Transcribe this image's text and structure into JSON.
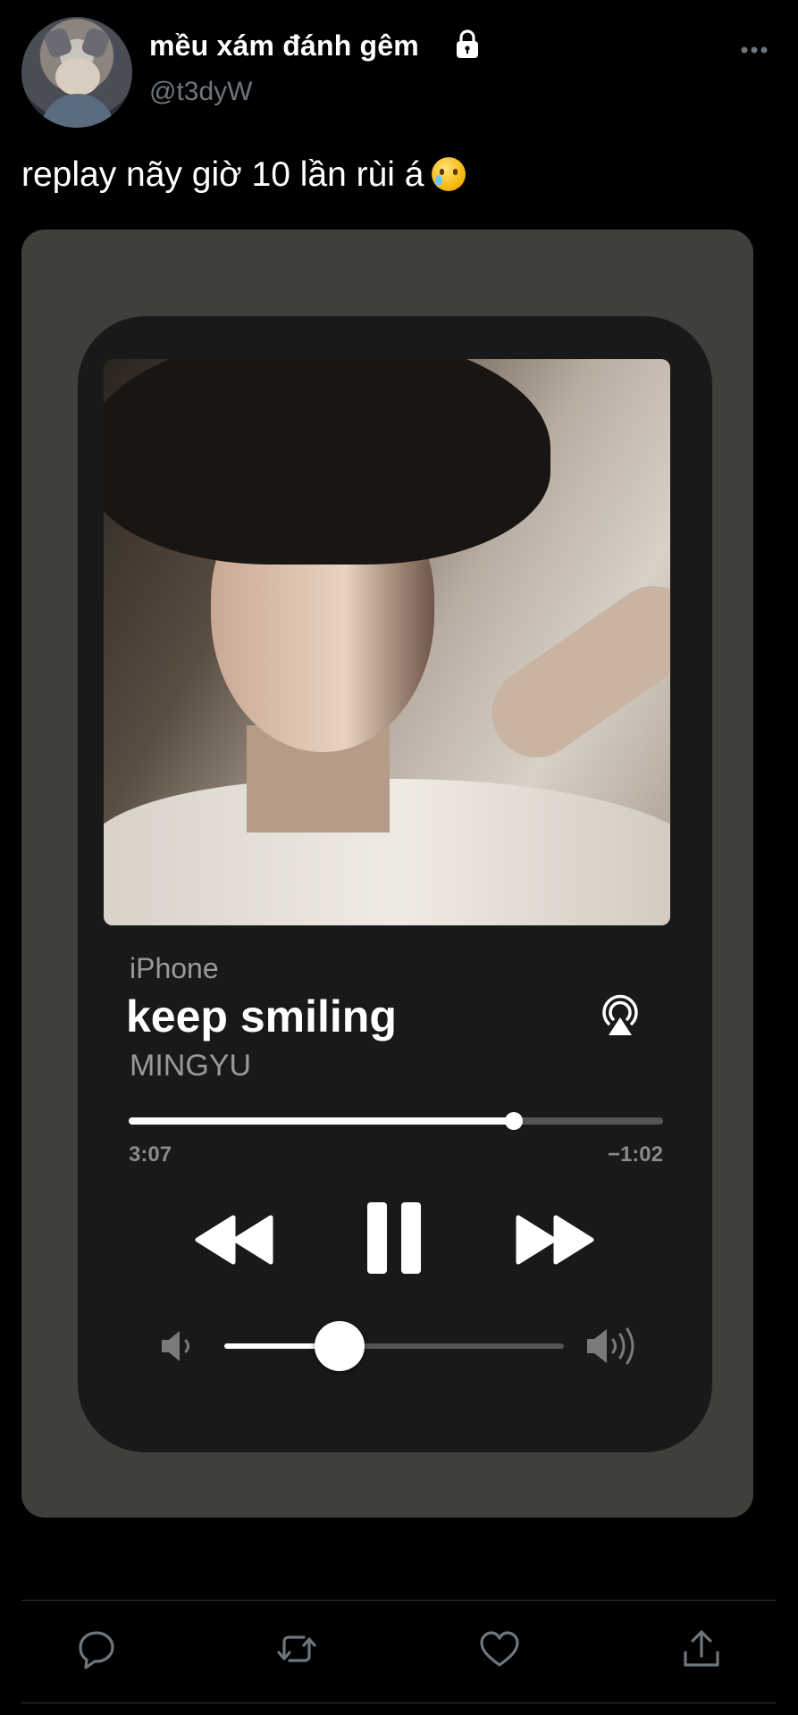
{
  "user": {
    "display_name": "mều xám đánh gêm",
    "handle": "@t3dyW",
    "avatar_icon": "avatar-cat-character",
    "protected_icon": "lock-icon"
  },
  "tweet": {
    "text": "replay nãy giờ 10 lần rùi á",
    "emoji": "face-holding-back-tears-emoji"
  },
  "player": {
    "source": "iPhone",
    "title": "keep smiling",
    "artist": "MINGYU",
    "elapsed": "3:07",
    "remaining": "−1:02",
    "progress_fraction": 0.72,
    "volume_fraction": 0.34,
    "icons": [
      "airplay-icon",
      "rewind-icon",
      "pause-icon",
      "fast-forward-icon",
      "volume-low-icon",
      "volume-high-icon"
    ]
  },
  "actions": {
    "icons": [
      "reply-icon",
      "retweet-icon",
      "like-icon",
      "share-icon"
    ]
  },
  "colors": {
    "background": "#000000",
    "media_card": "#3f403c",
    "player_panel": "#191919",
    "muted_text": "#6e767d"
  }
}
